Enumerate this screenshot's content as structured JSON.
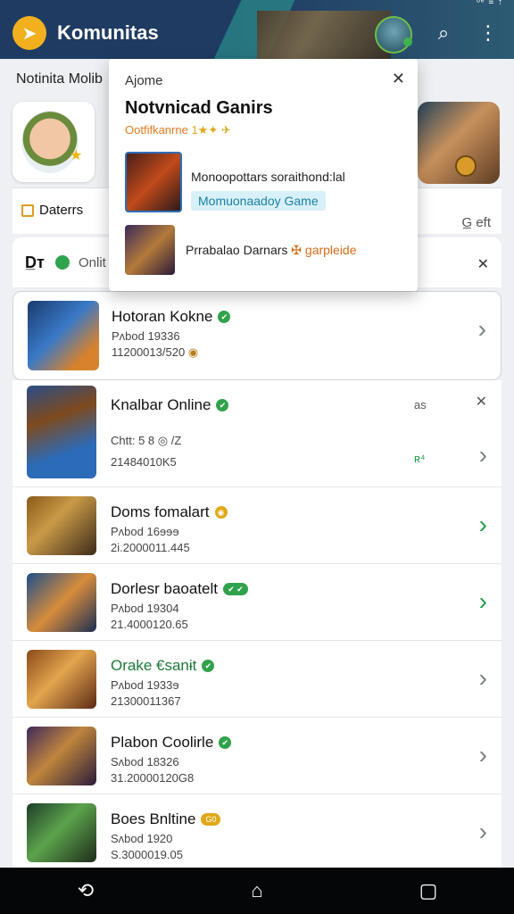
{
  "app": {
    "title": "Komunitas",
    "logo_icon": "paper-plane-icon",
    "search_icon": "search-icon",
    "menu_icon": "kebab-menu-icon",
    "status_text": "ᵒᵉ ≡ ↑"
  },
  "background": {
    "section_title": "Notinita Molib",
    "tab_left_label": "Daterrs",
    "tab_right_label": "G̲ eft",
    "filter_label": "D̲ᴛ",
    "filter_text": "Onlit",
    "filter_close": "✕"
  },
  "popup": {
    "label": "Ajome",
    "close": "✕",
    "title": "Notvnicad Ganirs",
    "subtitle": "Ootfifkanrne",
    "subtitle_stars": "1★✦ ✈",
    "item1_desc": "Monoopottars soraithond:lal",
    "item1_chip": "Momuonaadoy Game",
    "item2_desc_before": "Prrabalao Darnars",
    "item2_desc_accent": "✠ garpleide"
  },
  "list": [
    {
      "name": "Hotoran Kokne",
      "badge": "✔",
      "meta1": "Pʌbod 19336",
      "meta2": "11200013/520",
      "extra": "◉",
      "chevron": "›"
    },
    {
      "name": "Knalbar Online",
      "badge": "✔",
      "meta1": "Chtt: 5 8 ◎ /Z",
      "meta2": "21484010K5",
      "frag_top": "as",
      "frag_mid": "ʀ⁴",
      "close": "✕",
      "chevron": "›"
    },
    {
      "name": "Doms fomalart",
      "badge": "◉",
      "meta1": "Pʌbod 16ɘɘɘ",
      "meta2": "2i.2000011.445",
      "chevron": "›"
    },
    {
      "name": "Dorlesr baoatelt",
      "badge": "✔ ✔",
      "meta1": "Pʌbod 19304",
      "meta2": "21.4000120.65",
      "chevron": "›"
    },
    {
      "name": "Orake €sanɨt",
      "badge": "✔",
      "meta1": "Pʌbod 1933ɘ",
      "meta2": "21300011367",
      "chevron": "›"
    },
    {
      "name": "Plabon Coolirle",
      "badge": "✔",
      "meta1": "Sʌbod 18326",
      "meta2": "31.20000120G8",
      "chevron": "›"
    },
    {
      "name": "Boes Bnltine",
      "badge": "G0",
      "meta1": "Sʌbod 1920",
      "meta2": "S.3000019.05",
      "chevron": "›"
    }
  ],
  "nav": {
    "back": "⟲",
    "home": "⌂",
    "recents": "▢"
  },
  "colors": {
    "appbar": "#1f3b62",
    "accent_green": "#2ea44f",
    "accent_orange": "#e07a1e",
    "chip_blue": "#1b80a8"
  }
}
